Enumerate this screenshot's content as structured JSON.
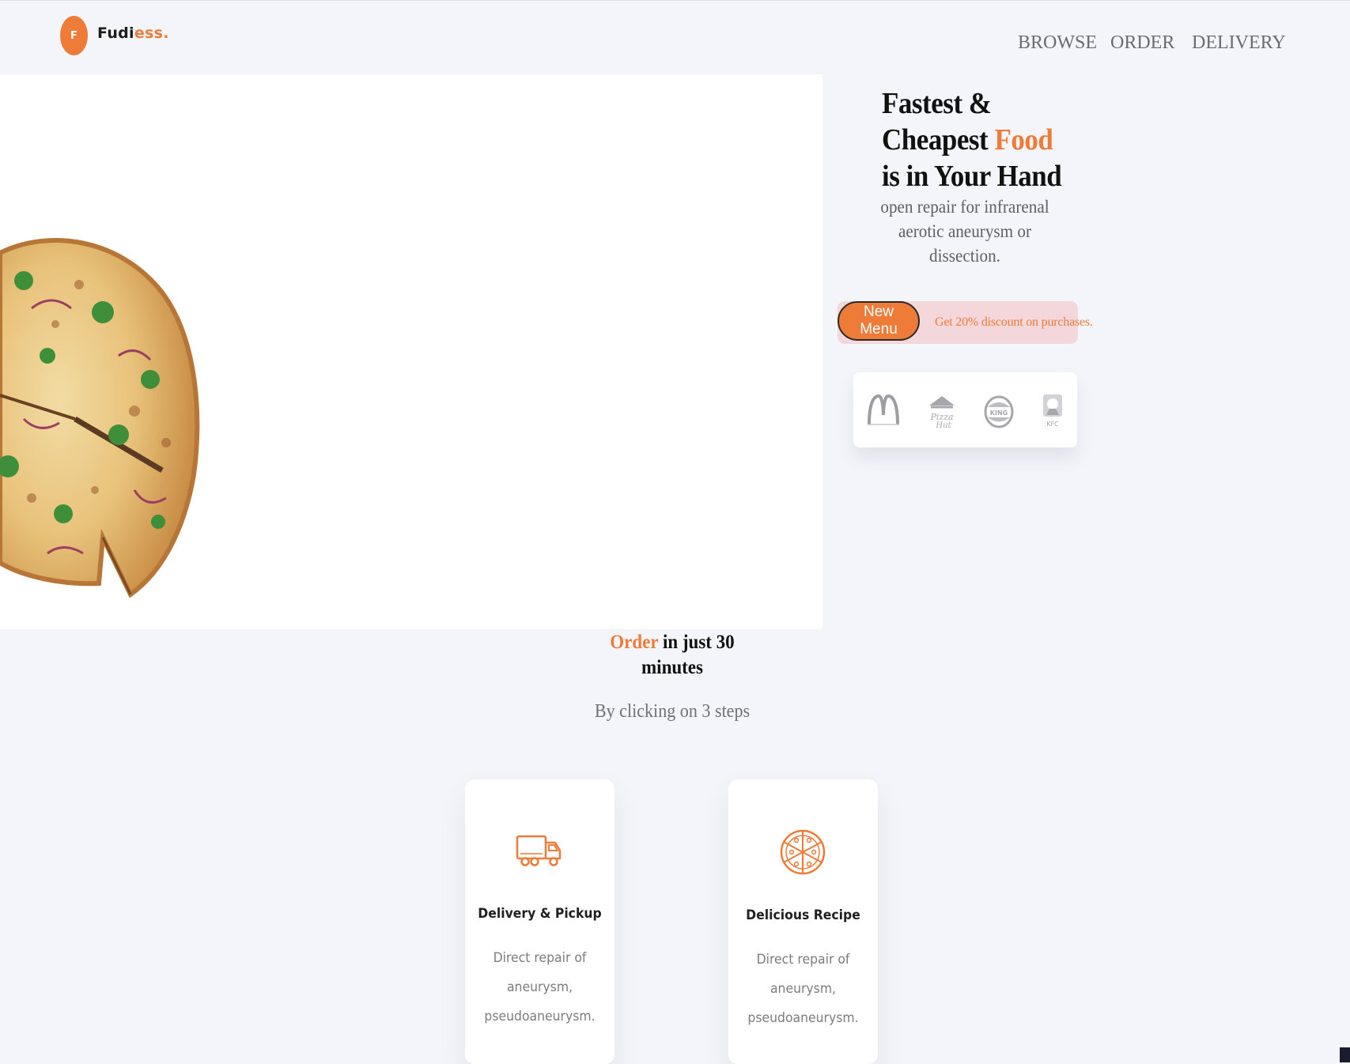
{
  "header": {
    "logo_initial": "F",
    "logo_prefix": "Fudi",
    "logo_highlight": "es",
    "logo_suffix": "s.",
    "nav": [
      "BROWSE",
      "ORDER",
      "DELIVERY"
    ]
  },
  "hero": {
    "title_line1": "Fastest &",
    "title_line2_prefix": "Cheapest",
    "title_line2_highlight": "Food",
    "title_line3": "is in Your Hand",
    "subtitle": "open repair for infrarenal aerotic aneurysm or dissection.",
    "promo_button": "New Menu",
    "promo_text": "Get 20% discount on purchases.",
    "brands": [
      "mcdonalds-logo",
      "pizza-hut-logo",
      "burger-king-logo",
      "kfc-logo"
    ]
  },
  "steps": {
    "title_highlight": "Order",
    "title_rest": "in just 30 minutes",
    "subtitle": "By clicking on 3 steps",
    "cards": [
      {
        "icon": "truck-icon",
        "title": "Delivery & Pickup",
        "desc_lines": [
          "Direct repair of",
          "aneurysm,",
          "pseudoaneurysm."
        ]
      },
      {
        "icon": "pizza-icon",
        "title": "Delicious Recipe",
        "desc_lines": [
          "Direct repair of",
          "aneurysm,",
          "pseudoaneurysm."
        ]
      }
    ]
  },
  "colors": {
    "accent": "#ee7b38",
    "background": "#f4f5fa",
    "promo_bg": "#f3d7db"
  }
}
